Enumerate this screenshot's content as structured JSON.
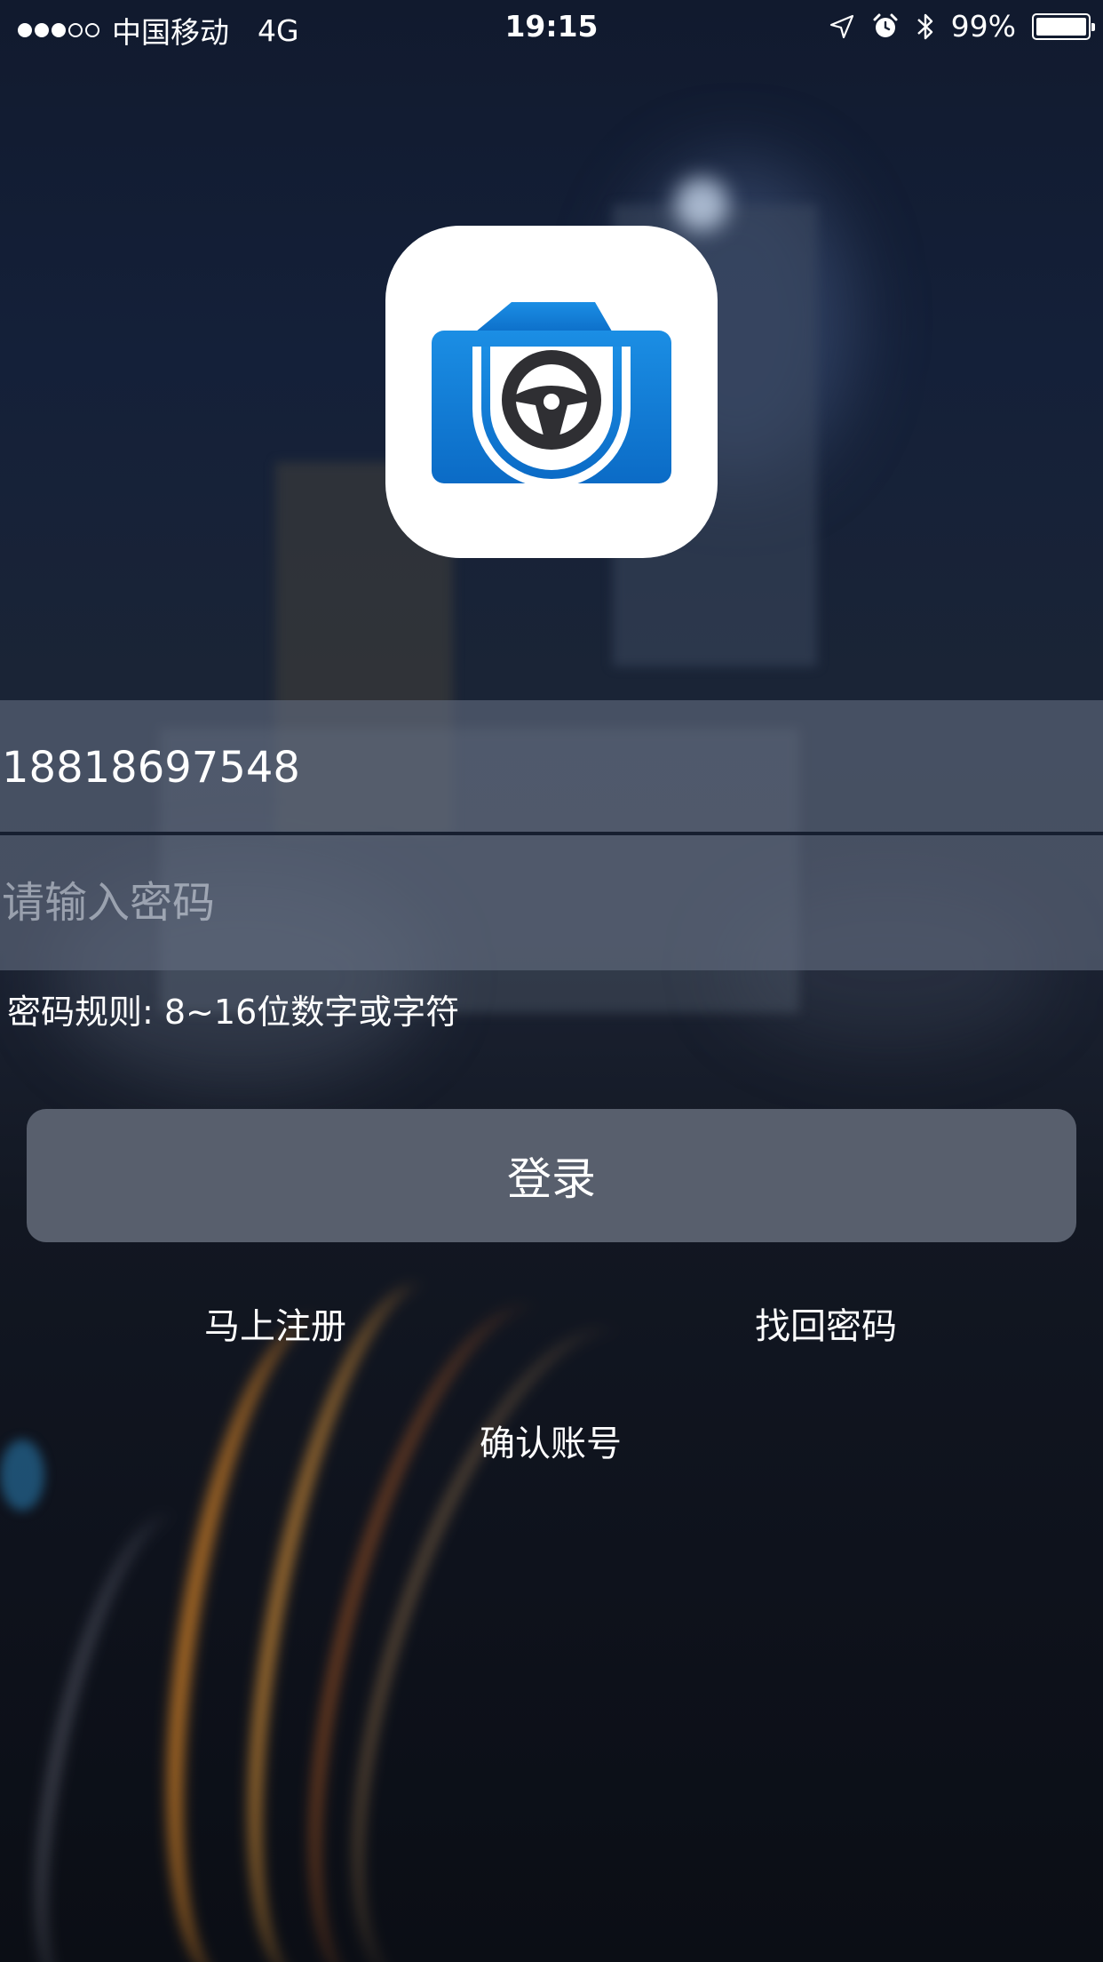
{
  "status_bar": {
    "carrier": "中国移动",
    "network": "4G",
    "time": "19:15",
    "battery_percent": "99%",
    "icons": [
      "location-icon",
      "alarm-icon",
      "bluetooth-icon",
      "battery-icon"
    ],
    "signal_strength": "3 of 5"
  },
  "app": {
    "logo_icon": "camera-steering-wheel-icon",
    "brand_color": "#1a7fd6"
  },
  "login_form": {
    "phone_value": "18818697548",
    "password_placeholder": "请输入密码",
    "password_rule": "密码规则: 8~16位数字或字符",
    "login_button_label": "登录"
  },
  "links": {
    "register": "马上注册",
    "forgot_password": "找回密码",
    "confirm_account": "确认账号"
  }
}
